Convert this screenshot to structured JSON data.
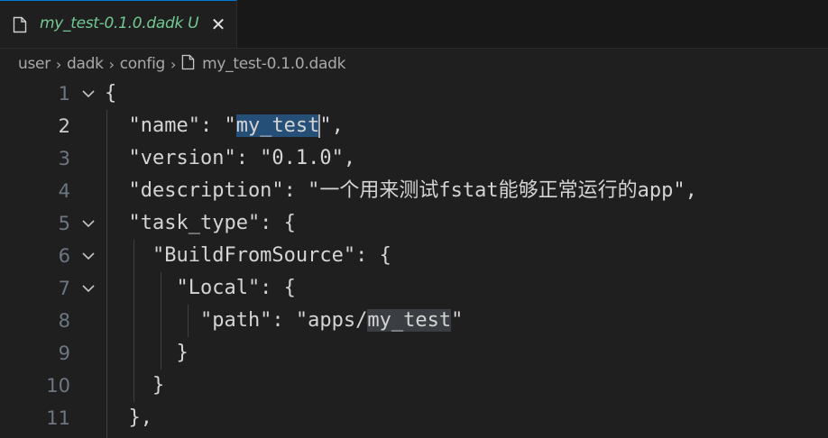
{
  "tab": {
    "title": "my_test-0.1.0.dadk",
    "status": "U",
    "close": "✕"
  },
  "breadcrumb": {
    "items": [
      "user",
      "dadk",
      "config"
    ],
    "file": "my_test-0.1.0.dadk",
    "separator": "›"
  },
  "editor": {
    "active_line": 2,
    "lines": [
      {
        "n": "1",
        "fold": true,
        "text": "{"
      },
      {
        "n": "2",
        "fold": false,
        "pre": "  \"name\": \"",
        "sel": "my_test",
        "post": "\","
      },
      {
        "n": "3",
        "fold": false,
        "text": "  \"version\": \"0.1.0\","
      },
      {
        "n": "4",
        "fold": false,
        "text": "  \"description\": \"一个用来测试fstat能够正常运行的app\","
      },
      {
        "n": "5",
        "fold": true,
        "text": "  \"task_type\": {"
      },
      {
        "n": "6",
        "fold": true,
        "text": "    \"BuildFromSource\": {"
      },
      {
        "n": "7",
        "fold": true,
        "text": "      \"Local\": {"
      },
      {
        "n": "8",
        "fold": false,
        "pre": "        \"path\": \"apps/",
        "hl": "my_test",
        "post": "\""
      },
      {
        "n": "9",
        "fold": false,
        "text": "      }"
      },
      {
        "n": "10",
        "fold": false,
        "text": "    }"
      },
      {
        "n": "11",
        "fold": false,
        "text": "  },"
      }
    ]
  },
  "colors": {
    "accent": "#0078d4",
    "modified": "#73c991",
    "selection": "#264f78"
  }
}
